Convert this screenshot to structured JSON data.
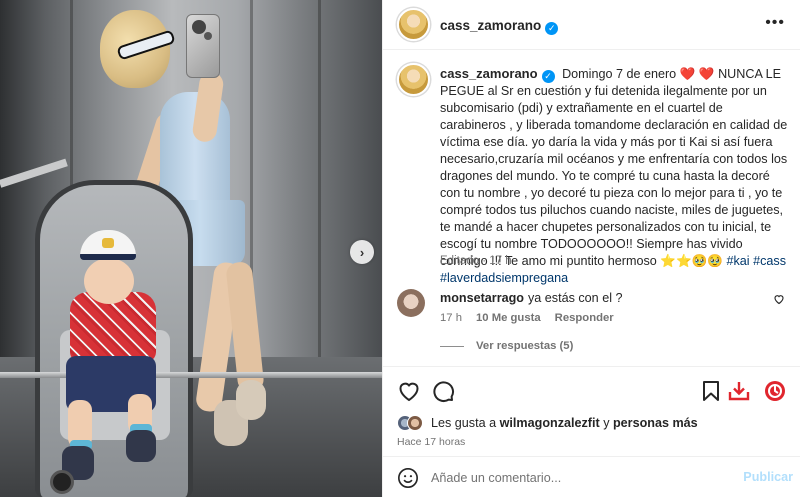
{
  "post": {
    "username": "cass_zamorano",
    "verified": true,
    "more_label": "•••",
    "caption_date": "Domingo 7 de enero",
    "caption_hearts": "❤️ ❤️",
    "caption_text": "NUNCA LE PEGUE al Sr en cuestión y fui detenida ilegalmente por un subcomisario (pdi) y extrañamente en el cuartel de carabineros , y liberada tomandome declaración en calidad de víctima ese día. yo daría la vida y más por ti Kai si así fuera necesario,cruzaría mil océanos y me enfrentaría con todos los dragones del mundo. Yo te compré tu cuna hasta la decoré con tu nombre , yo decoré tu pieza con lo mejor para ti , yo te compré todos tus piluchos cuando naciste, miles de juguetes, te mandé a hacer chupetes personalizados con tu inicial, te escogí tu nombre TODOOOOOO!! Siempre has vivido conmigo !!! Te amo mi puntito hermoso",
    "caption_emojis": "⭐⭐🥹🥹",
    "hashtags": [
      "#kai",
      "#cass",
      "#laverdadsiempregana"
    ],
    "edited_label": "Editado",
    "edited_time": "17 h"
  },
  "comment": {
    "username": "monsetarrago",
    "text": "ya estás con el ?",
    "time": "17 h",
    "likes": "10 Me gusta",
    "reply_label": "Responder",
    "view_replies": "Ver respuestas (5)"
  },
  "likes": {
    "prefix": "Les gusta a",
    "user": "wilmagonzalezfit",
    "connector": "y",
    "others": "personas más"
  },
  "timestamp": "Hace 17 horas",
  "add_comment": {
    "placeholder": "Añade un comentario...",
    "post_label": "Publicar"
  },
  "icons": {
    "like": "heart-icon",
    "comment": "comment-icon",
    "share": "share-icon",
    "bookmark": "bookmark-icon",
    "download": "download-icon",
    "extension": "extension-icon",
    "emoji": "emoji-icon",
    "next": "chevron-right-icon"
  },
  "colors": {
    "verified": "#0095f6",
    "download": "#e0262e",
    "extension": "#e0262e",
    "post_button": "#b2dffc",
    "hashtag": "#00376b"
  },
  "next_arrow": "›"
}
